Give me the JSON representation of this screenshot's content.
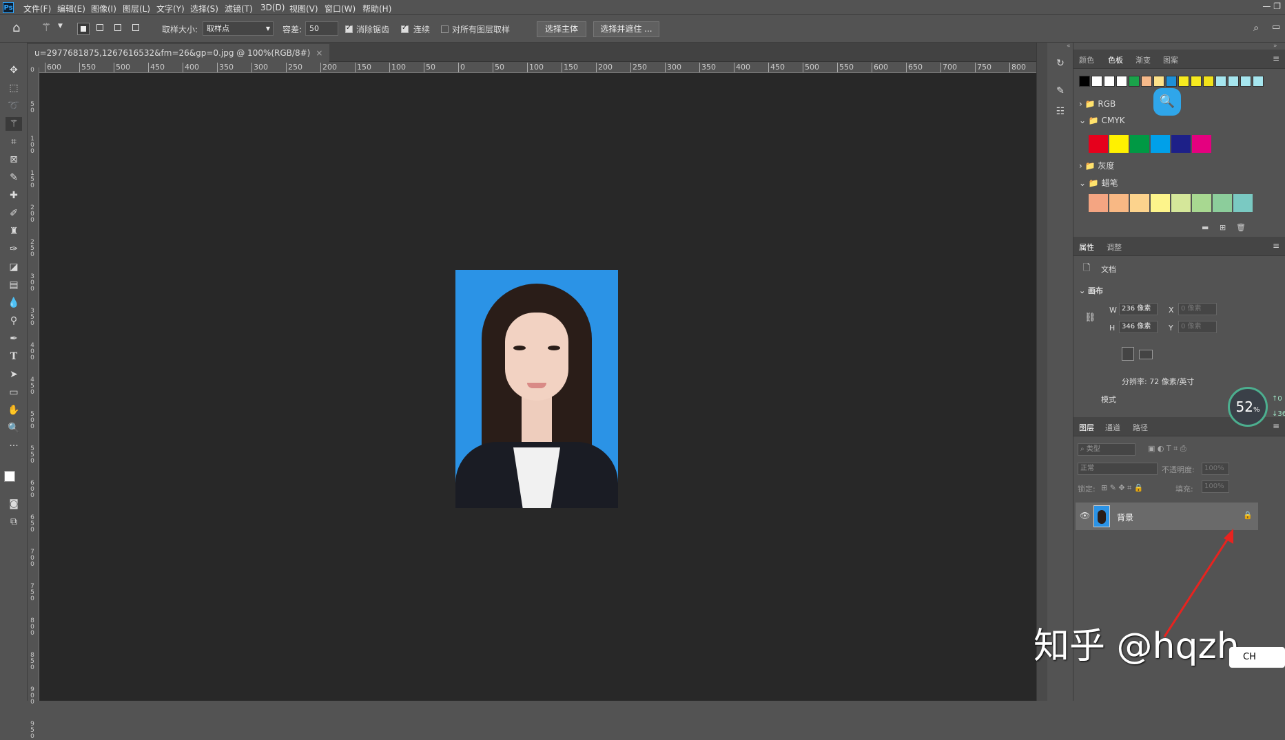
{
  "app": {
    "logo": "Ps"
  },
  "menu": [
    "文件(F)",
    "编辑(E)",
    "图像(I)",
    "图层(L)",
    "文字(Y)",
    "选择(S)",
    "滤镜(T)",
    "3D(D)",
    "视图(V)",
    "窗口(W)",
    "帮助(H)"
  ],
  "options": {
    "sample_size_label": "取样大小:",
    "sample_size_value": "取样点",
    "tolerance_label": "容差:",
    "tolerance_value": "50",
    "antialias_label": "消除锯齿",
    "contiguous_label": "连续",
    "sample_all_label": "对所有图层取样",
    "select_subject": "选择主体",
    "select_mask": "选择并遮住 ..."
  },
  "document": {
    "tab_title": "u=2977681875,1267616532&fm=26&gp=0.jpg @ 100%(RGB/8#)"
  },
  "ruler": {
    "h": [
      "600",
      "550",
      "500",
      "450",
      "400",
      "350",
      "300",
      "250",
      "200",
      "150",
      "100",
      "50",
      "0",
      "50",
      "100",
      "150",
      "200",
      "250",
      "300",
      "350",
      "400",
      "450",
      "500",
      "550",
      "600",
      "650",
      "700",
      "750",
      "800"
    ],
    "v": [
      "0",
      "5 0",
      "1 0 0",
      "1 5 0",
      "2 0 0",
      "2 5 0",
      "3 0 0",
      "3 5 0",
      "4 0 0",
      "4 5 0",
      "5 0 0",
      "5 5 0",
      "6 0 0",
      "6 5 0",
      "7 0 0",
      "7 5 0",
      "8 0 0",
      "8 5 0",
      "9 0 0",
      "9 5 0"
    ]
  },
  "swatches_panel": {
    "tabs": [
      "颜色",
      "色板",
      "渐变",
      "图案"
    ],
    "recent": [
      "#000000",
      "#ffffff",
      "#ffffff",
      "#ffffff",
      "#1aa34a",
      "#f6b98a",
      "#fde28a",
      "#1e90d8",
      "#f7ea1f",
      "#f7ea1f",
      "#f2e21a",
      "#a6e6ef",
      "#a6e6ef",
      "#a6e6ef",
      "#a6e6ef"
    ],
    "groups": {
      "rgb": "RGB",
      "cmyk": "CMYK",
      "gray": "灰度",
      "crayon": "蜡笔"
    },
    "cmyk_colors": [
      "#e6001c",
      "#fff100",
      "#009944",
      "#00a0e9",
      "#1d2088",
      "#e4007f"
    ],
    "crayon_colors": [
      "#f4a582",
      "#f8b884",
      "#fcd38d",
      "#fdf48b",
      "#d5e79a",
      "#a8d891",
      "#8ccd9b",
      "#7ac9c2"
    ]
  },
  "properties_panel": {
    "tabs": [
      "属性",
      "调整"
    ],
    "doc_label": "文档",
    "canvas_label": "画布",
    "w_label": "W",
    "w_value": "236 像素",
    "h_label": "H",
    "h_value": "346 像素",
    "x_label": "X",
    "x_placeholder": "0 像素",
    "y_label": "Y",
    "y_placeholder": "0 像素",
    "resolution": "分辨率: 72 像素/英寸",
    "mode_label": "模式"
  },
  "gauge": {
    "value": "52",
    "unit": "%",
    "up": "0",
    "down": "36"
  },
  "layers_panel": {
    "tabs": [
      "图层",
      "通道",
      "路径"
    ],
    "filter_label": "类型",
    "blend_mode": "正常",
    "opacity_label": "不透明度:",
    "opacity_value": "100%",
    "lock_label": "锁定:",
    "fill_label": "填充:",
    "fill_value": "100%",
    "layer_name": "背景"
  },
  "watermark": "知乎 @hqzh",
  "ime": "CH"
}
